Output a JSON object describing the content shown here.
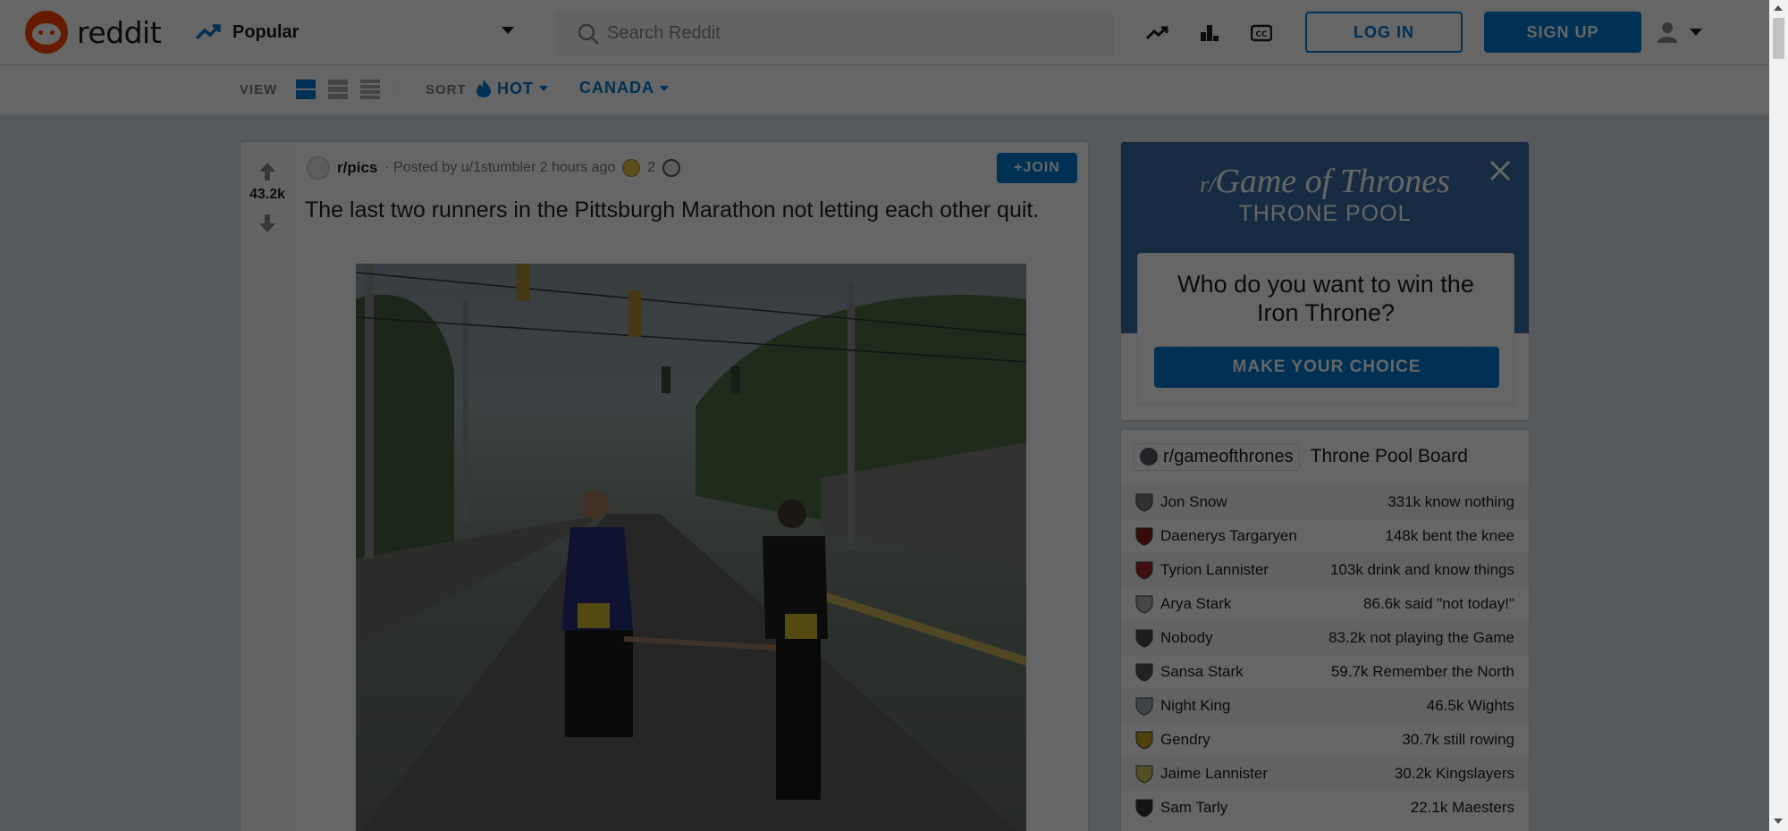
{
  "header": {
    "logo_text": "reddit",
    "feed_label": "Popular",
    "search_placeholder": "Search Reddit",
    "login_label": "LOG IN",
    "signup_label": "SIGN UP",
    "icons": [
      "trending-icon",
      "leaderboard-icon",
      "coins-icon",
      "user-icon",
      "chevron-down-icon"
    ]
  },
  "subheader": {
    "view_label": "VIEW",
    "sort_label": "SORT",
    "sort_value": "HOT",
    "location_value": "CANADA",
    "views": [
      "card",
      "classic",
      "compact"
    ]
  },
  "post": {
    "votes": "43.2k",
    "subreddit": "r/pics",
    "posted_by": "· Posted by u/1stumbler 2 hours ago",
    "award_count": "2",
    "join_label": "+JOIN",
    "title": "The last two runners in the Pittsburgh Marathon not letting each other quit."
  },
  "sidebar": {
    "promo": {
      "title_prefix": "r/",
      "title": "Game of Thrones",
      "subtitle": "THRONE POOL",
      "question": "Who do you want to win the Iron Throne?",
      "button_label": "MAKE YOUR CHOICE"
    },
    "board": {
      "subreddit": "r/gameofthrones",
      "title": "Throne Pool Board",
      "rows": [
        {
          "name": "Jon Snow",
          "count": "331k know nothing",
          "color": "#7a7a7a"
        },
        {
          "name": "Daenerys Targaryen",
          "count": "148k bent the knee",
          "color": "#8b1a1a"
        },
        {
          "name": "Tyrion Lannister",
          "count": "103k drink and know things",
          "color": "#a52a2a"
        },
        {
          "name": "Arya Stark",
          "count": "86.6k said \"not today!\"",
          "color": "#b0b0b0"
        },
        {
          "name": "Nobody",
          "count": "83.2k not playing the Game",
          "color": "#4a4a4a"
        },
        {
          "name": "Sansa Stark",
          "count": "59.7k Remember the North",
          "color": "#555555"
        },
        {
          "name": "Night King",
          "count": "46.5k Wights",
          "color": "#9aa7b0"
        },
        {
          "name": "Gendry",
          "count": "30.7k still rowing",
          "color": "#c8a020"
        },
        {
          "name": "Jaime Lannister",
          "count": "30.2k Kingslayers",
          "color": "#c8c85a"
        },
        {
          "name": "Sam Tarly",
          "count": "22.1k Maesters",
          "color": "#333333"
        }
      ]
    }
  },
  "colors": {
    "brand": "#ff4500",
    "accent": "#0079d3",
    "overlay": "rgba(0,0,0,0.6)"
  }
}
